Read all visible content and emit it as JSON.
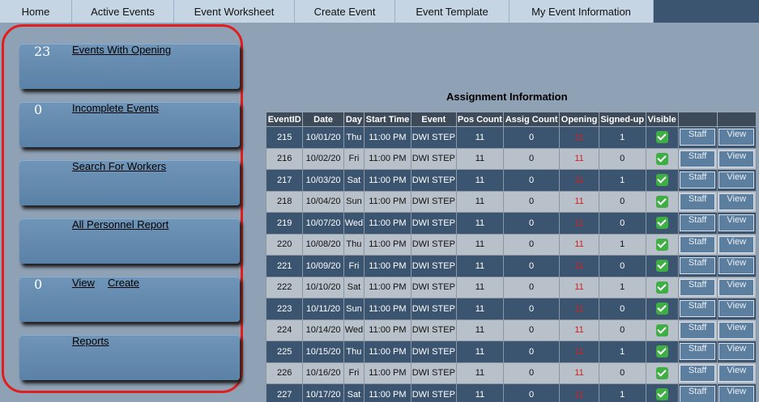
{
  "nav": {
    "tabs": [
      "Home",
      "Active Events",
      "Event Worksheet",
      "Create Event",
      "Event Template",
      "My Event Information"
    ]
  },
  "left_panel": {
    "events_opening": {
      "count": "23",
      "label": "Events With Opening"
    },
    "incomplete": {
      "count": "0",
      "label": "Incomplete Events"
    },
    "search": {
      "label": "Search For Workers"
    },
    "personnel": {
      "label": "All Personnel Report"
    },
    "view_create": {
      "count": "0",
      "view_label": "View",
      "create_label": "Create"
    },
    "reports": {
      "label": "Reports"
    }
  },
  "assignment": {
    "title": "Assignment Information",
    "columns": [
      "EventID",
      "Date",
      "Day",
      "Start Time",
      "Event",
      "Pos Count",
      "Assig Count",
      "Opening",
      "Signed-up",
      "Visible",
      "",
      ""
    ],
    "rows": [
      {
        "id": "215",
        "date": "10/01/20",
        "day": "Thu",
        "time": "11:00 PM",
        "event": "DWI STEP",
        "pos": "11",
        "assig": "0",
        "opening": "11",
        "signed": "1",
        "staff": "Staff",
        "view": "View"
      },
      {
        "id": "216",
        "date": "10/02/20",
        "day": "Fri",
        "time": "11:00 PM",
        "event": "DWI STEP",
        "pos": "11",
        "assig": "0",
        "opening": "11",
        "signed": "0",
        "staff": "Staff",
        "view": "View"
      },
      {
        "id": "217",
        "date": "10/03/20",
        "day": "Sat",
        "time": "11:00 PM",
        "event": "DWI STEP",
        "pos": "11",
        "assig": "0",
        "opening": "11",
        "signed": "1",
        "staff": "Staff",
        "view": "View"
      },
      {
        "id": "218",
        "date": "10/04/20",
        "day": "Sun",
        "time": "11:00 PM",
        "event": "DWI STEP",
        "pos": "11",
        "assig": "0",
        "opening": "11",
        "signed": "0",
        "staff": "Staff",
        "view": "View"
      },
      {
        "id": "219",
        "date": "10/07/20",
        "day": "Wed",
        "time": "11:00 PM",
        "event": "DWI STEP",
        "pos": "11",
        "assig": "0",
        "opening": "11",
        "signed": "0",
        "staff": "Staff",
        "view": "View"
      },
      {
        "id": "220",
        "date": "10/08/20",
        "day": "Thu",
        "time": "11:00 PM",
        "event": "DWI STEP",
        "pos": "11",
        "assig": "0",
        "opening": "11",
        "signed": "1",
        "staff": "Staff",
        "view": "View"
      },
      {
        "id": "221",
        "date": "10/09/20",
        "day": "Fri",
        "time": "11:00 PM",
        "event": "DWI STEP",
        "pos": "11",
        "assig": "0",
        "opening": "11",
        "signed": "0",
        "staff": "Staff",
        "view": "View"
      },
      {
        "id": "222",
        "date": "10/10/20",
        "day": "Sat",
        "time": "11:00 PM",
        "event": "DWI STEP",
        "pos": "11",
        "assig": "0",
        "opening": "11",
        "signed": "1",
        "staff": "Staff",
        "view": "View"
      },
      {
        "id": "223",
        "date": "10/11/20",
        "day": "Sun",
        "time": "11:00 PM",
        "event": "DWI STEP",
        "pos": "11",
        "assig": "0",
        "opening": "11",
        "signed": "0",
        "staff": "Staff",
        "view": "View"
      },
      {
        "id": "224",
        "date": "10/14/20",
        "day": "Wed",
        "time": "11:00 PM",
        "event": "DWI STEP",
        "pos": "11",
        "assig": "0",
        "opening": "11",
        "signed": "0",
        "staff": "Staff",
        "view": "View"
      },
      {
        "id": "225",
        "date": "10/15/20",
        "day": "Thu",
        "time": "11:00 PM",
        "event": "DWI STEP",
        "pos": "11",
        "assig": "0",
        "opening": "11",
        "signed": "1",
        "staff": "Staff",
        "view": "View"
      },
      {
        "id": "226",
        "date": "10/16/20",
        "day": "Fri",
        "time": "11:00 PM",
        "event": "DWI STEP",
        "pos": "11",
        "assig": "0",
        "opening": "11",
        "signed": "0",
        "staff": "Staff",
        "view": "View"
      },
      {
        "id": "227",
        "date": "10/17/20",
        "day": "Sat",
        "time": "11:00 PM",
        "event": "DWI STEP",
        "pos": "11",
        "assig": "0",
        "opening": "11",
        "signed": "1",
        "staff": "Staff",
        "view": "View"
      }
    ]
  },
  "colors": {
    "row_dark": "#3b5570",
    "row_light": "#b8c0c9",
    "opening_red": "#d32020",
    "highlight_border": "#e21d1d"
  },
  "icons": {
    "visible": "checkbox-checked-icon"
  }
}
